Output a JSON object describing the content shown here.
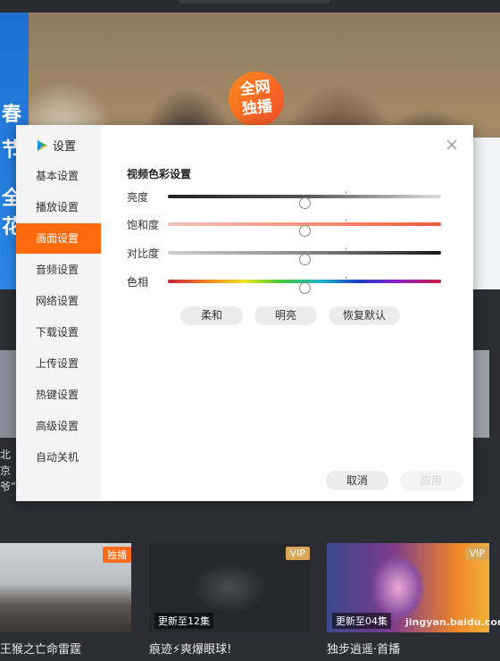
{
  "background": {
    "banner_badge": [
      "全网",
      "独播"
    ],
    "banner_side_text": [
      "春",
      "节",
      "全",
      "花"
    ],
    "mid_left_text": "北京 爷”",
    "mid_right_text": "]",
    "cards": [
      {
        "tag": "独播",
        "tag_color": "#ff6a1a",
        "update": "",
        "title": "王猴之亡命雷霆"
      },
      {
        "tag": "VIP",
        "tag_color": "#d9a556",
        "update": "更新至12集",
        "title": "痕迹⚡爽爆眼球!"
      },
      {
        "tag": "VIP",
        "tag_color": "#d9a556",
        "update": "更新至04集",
        "title": "独步逍遥·首播"
      }
    ],
    "watermark": "jingyan.baidu.com"
  },
  "dialog": {
    "title": "设置",
    "close_icon": "close-icon",
    "sidebar": {
      "items": [
        {
          "label": "基本设置",
          "active": false
        },
        {
          "label": "播放设置",
          "active": false
        },
        {
          "label": "画面设置",
          "active": true
        },
        {
          "label": "音频设置",
          "active": false
        },
        {
          "label": "网络设置",
          "active": false
        },
        {
          "label": "下载设置",
          "active": false
        },
        {
          "label": "上传设置",
          "active": false
        },
        {
          "label": "热键设置",
          "active": false
        },
        {
          "label": "高级设置",
          "active": false
        },
        {
          "label": "自动关机",
          "active": false
        }
      ]
    },
    "section_title": "视频色彩设置",
    "sliders": [
      {
        "label": "亮度",
        "value": 0.5
      },
      {
        "label": "饱和度",
        "value": 0.5
      },
      {
        "label": "对比度",
        "value": 0.5
      },
      {
        "label": "色相",
        "value": 0.5
      }
    ],
    "presets": [
      "柔和",
      "明亮",
      "恢复默认"
    ],
    "cancel_label": "取消",
    "apply_label": "应用",
    "accent_color": "#ff6a0c"
  }
}
